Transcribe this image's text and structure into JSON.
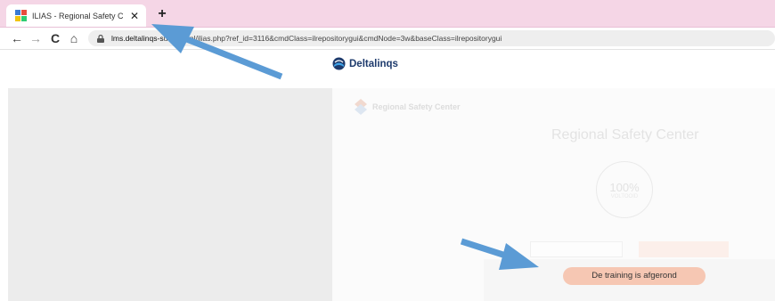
{
  "browser": {
    "tab_title": "ILIAS - Regional Safety Center In",
    "tab_close": "✕",
    "new_tab": "+",
    "nav": {
      "back": "←",
      "forward": "→",
      "reload": "C",
      "home": "⌂"
    },
    "url_host": "lms.deltalinqs-s",
    "url_rest": "uctions.nl/ilias.php?ref_id=3116&cmdClass=ilrepositorygui&cmdNode=3w&baseClass=ilrepositorygui"
  },
  "page": {
    "logo_text": "Deltalinqs",
    "brand_text": "Regional Safety Center",
    "title": "Regional Safety Center",
    "progress_pct": "100%",
    "progress_sub": "VOLTOOID",
    "completed_label": "De training is afgerond"
  },
  "colors": {
    "tabstrip": "#f5d6e6",
    "arrow": "#5b9bd5",
    "pill": "#f6c7b3"
  }
}
